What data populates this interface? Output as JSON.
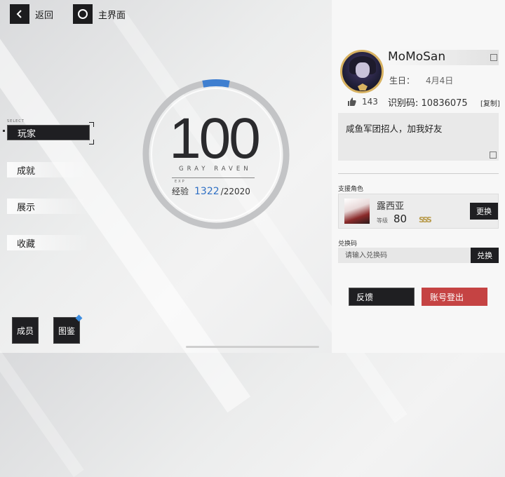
{
  "top": {
    "back_label": "返回",
    "home_label": "主界面"
  },
  "nav": {
    "tag": "SELECT",
    "items": [
      {
        "label": "玩家",
        "active": true
      },
      {
        "label": "成就",
        "active": false
      },
      {
        "label": "展示",
        "active": false
      },
      {
        "label": "收藏",
        "active": false
      }
    ]
  },
  "bottom": {
    "members_label": "成员",
    "atlas_label": "图鉴"
  },
  "level": {
    "value": "100",
    "subtitle": "GRAY RAVEN",
    "exp_tag": "EXP",
    "exp_label": "经验",
    "exp_current": "1322",
    "exp_max": "/22020",
    "exp_fraction": 0.06
  },
  "profile": {
    "name": "MoMoSan",
    "birthday_label": "生日：",
    "birthday_value": "4月4日",
    "likes": "143",
    "uid_label": "识别码:",
    "uid_value": "10836075",
    "copy_label": "[复制]",
    "signature": "咸鱼军团招人，加我好友",
    "support_section": "支援角色",
    "support_name": "露西亚",
    "support_level_label": "等级",
    "support_level": "80",
    "support_rank": "SSS",
    "change_label": "更换",
    "code_section": "兑换码",
    "code_placeholder": "请输入兑换码",
    "redeem_label": "兑换",
    "feedback_label": "反馈",
    "logout_label": "账号登出"
  },
  "colors": {
    "accent_blue": "#3f7fd0",
    "logout_red": "#c54343",
    "dark_button": "#1f1f22"
  }
}
